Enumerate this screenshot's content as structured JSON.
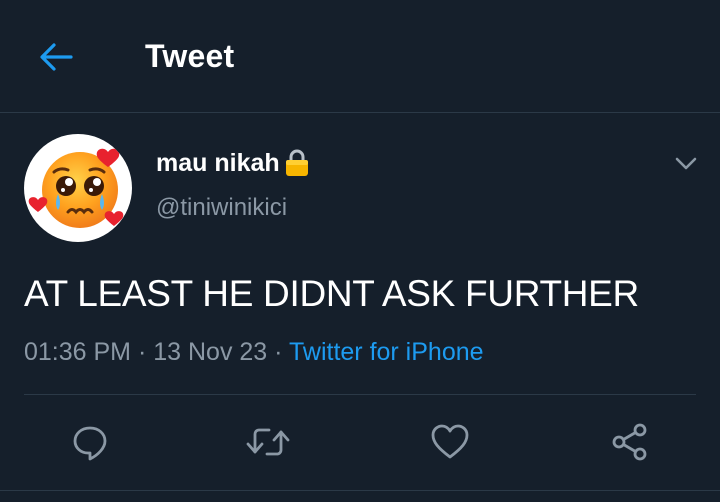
{
  "header": {
    "title": "Tweet",
    "back_icon": "arrow-left-icon"
  },
  "author": {
    "display_name": "mau nikah",
    "handle": "@tiniwinikici",
    "protected_icon": "lock-icon",
    "avatar_icon": "pleading-face-hearts-emoji"
  },
  "tweet": {
    "text": "AT LEAST HE DIDNT ASK FURTHER",
    "time": "01:36 PM",
    "date": "13 Nov 23",
    "separator": "·",
    "source": "Twitter for iPhone"
  },
  "actions": [
    {
      "icon": "reply-icon"
    },
    {
      "icon": "retweet-icon"
    },
    {
      "icon": "like-icon"
    },
    {
      "icon": "share-icon"
    }
  ],
  "colors": {
    "background": "#151f2b",
    "text": "#ffffff",
    "secondary_text": "#8b98a5",
    "accent": "#1d9bf0",
    "divider": "#2b3947"
  }
}
